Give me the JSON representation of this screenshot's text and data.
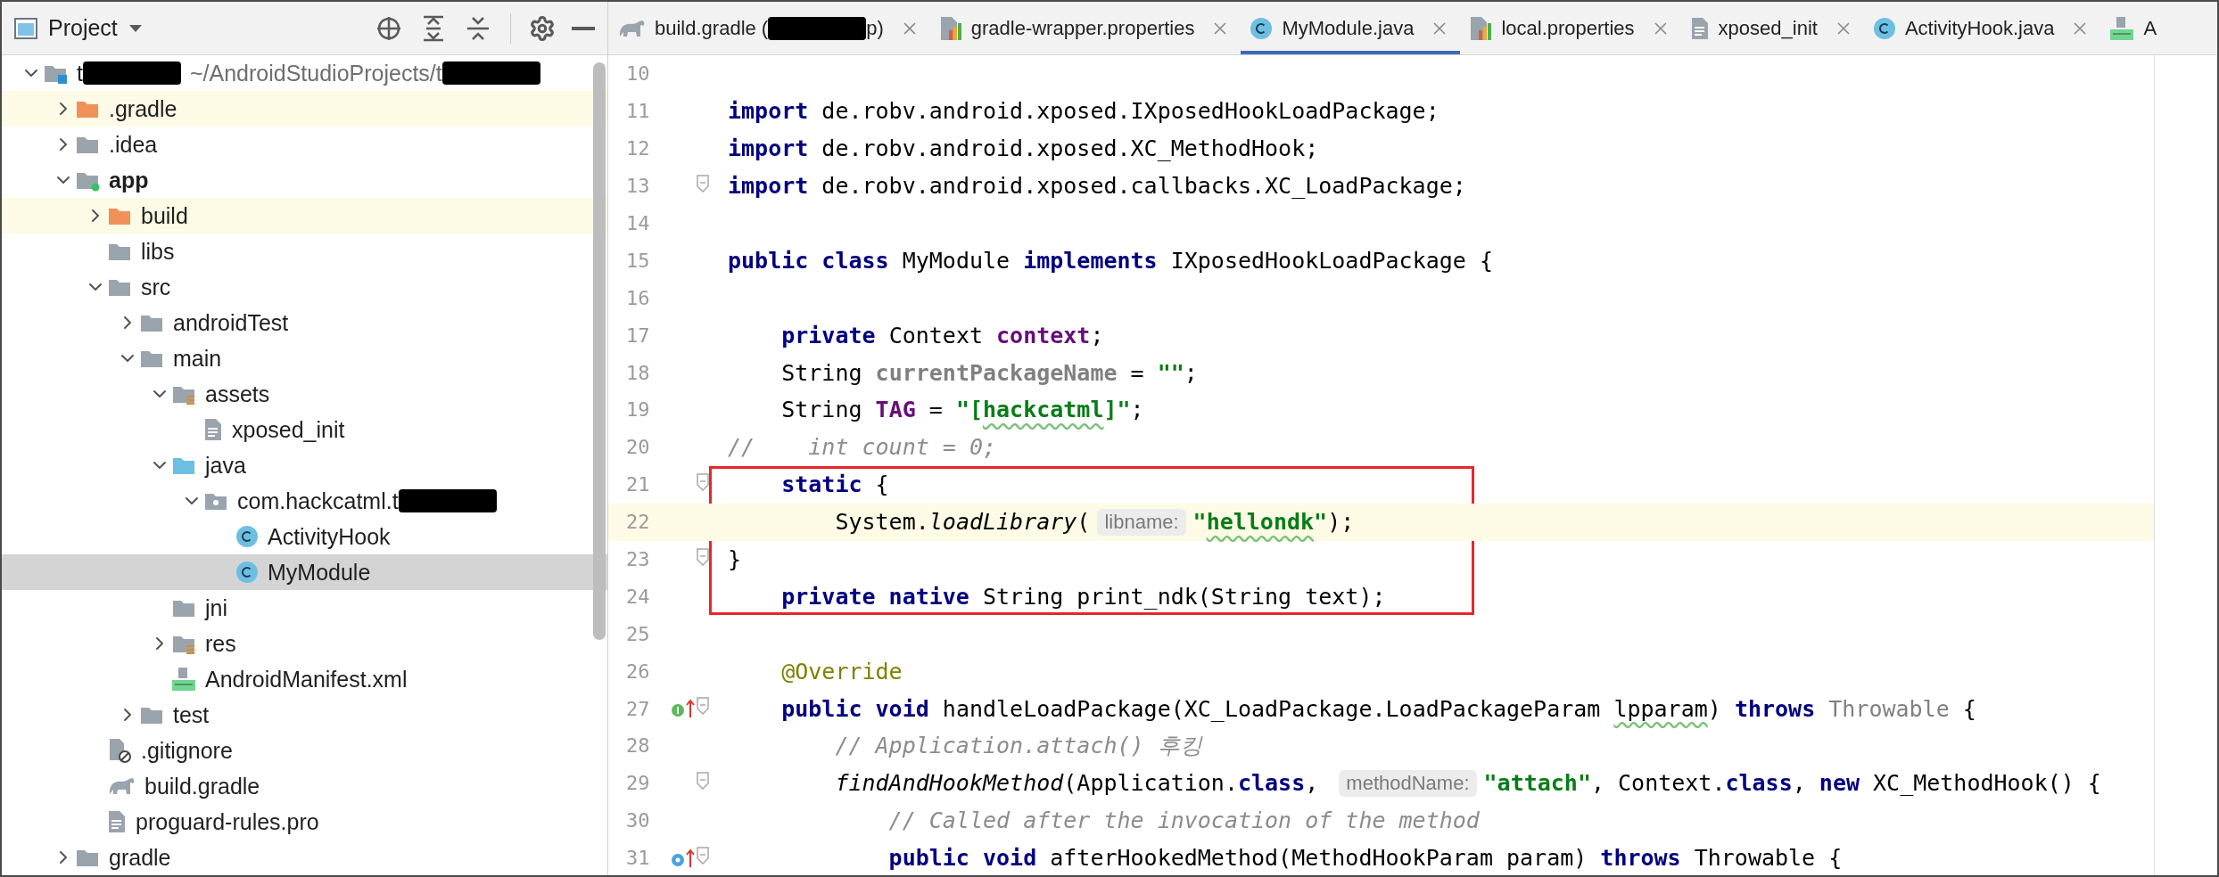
{
  "project_panel": {
    "title": "Project",
    "tree": [
      {
        "parts": [
          {
            "kind": "name",
            "text": "t"
          },
          {
            "kind": "redaction"
          },
          {
            "kind": "path",
            "text": "~/AndroidStudioProjects/t"
          },
          {
            "kind": "redaction"
          }
        ],
        "kind": "module-root",
        "expanded": true,
        "selected": false,
        "excluded": false,
        "bold": false,
        "children": [
          {
            "label": ".gradle",
            "kind": "folder-excluded",
            "expanded": false,
            "selected": false,
            "excluded": true,
            "bold": false
          },
          {
            "label": ".idea",
            "kind": "folder",
            "expanded": false,
            "selected": false,
            "excluded": false,
            "bold": false
          },
          {
            "label": "app",
            "kind": "module",
            "expanded": true,
            "selected": false,
            "excluded": false,
            "bold": true,
            "children": [
              {
                "label": "build",
                "kind": "folder-excluded",
                "expanded": false,
                "selected": false,
                "excluded": true,
                "bold": false
              },
              {
                "label": "libs",
                "kind": "folder",
                "selected": false,
                "excluded": false,
                "bold": false
              },
              {
                "label": "src",
                "kind": "folder",
                "expanded": true,
                "selected": false,
                "excluded": false,
                "bold": false,
                "children": [
                  {
                    "label": "androidTest",
                    "kind": "folder",
                    "expanded": false,
                    "selected": false,
                    "excluded": false,
                    "bold": false
                  },
                  {
                    "label": "main",
                    "kind": "folder",
                    "expanded": true,
                    "selected": false,
                    "excluded": false,
                    "bold": false,
                    "children": [
                      {
                        "label": "assets",
                        "kind": "folder-resources",
                        "expanded": true,
                        "selected": false,
                        "excluded": false,
                        "bold": false,
                        "children": [
                          {
                            "label": "xposed_init",
                            "kind": "file-text",
                            "selected": false,
                            "excluded": false,
                            "bold": false
                          }
                        ]
                      },
                      {
                        "label": "java",
                        "kind": "folder-source",
                        "expanded": true,
                        "selected": false,
                        "excluded": false,
                        "bold": false,
                        "children": [
                          {
                            "parts": [
                              {
                                "kind": "name",
                                "text": "com.hackcatml.t"
                              },
                              {
                                "kind": "redaction"
                              }
                            ],
                            "kind": "folder-package",
                            "expanded": true,
                            "selected": false,
                            "excluded": false,
                            "bold": false,
                            "children": [
                              {
                                "label": "ActivityHook",
                                "kind": "class",
                                "selected": false,
                                "excluded": false,
                                "bold": false
                              },
                              {
                                "label": "MyModule",
                                "kind": "class",
                                "selected": true,
                                "excluded": false,
                                "bold": false
                              }
                            ]
                          }
                        ]
                      },
                      {
                        "label": "jni",
                        "kind": "folder",
                        "selected": false,
                        "excluded": false,
                        "bold": false
                      },
                      {
                        "label": "res",
                        "kind": "folder-resources",
                        "expanded": false,
                        "selected": false,
                        "excluded": false,
                        "bold": false
                      },
                      {
                        "label": "AndroidManifest.xml",
                        "kind": "manifest",
                        "selected": false,
                        "excluded": false,
                        "bold": false
                      }
                    ]
                  },
                  {
                    "label": "test",
                    "kind": "folder",
                    "expanded": false,
                    "selected": false,
                    "excluded": false,
                    "bold": false
                  }
                ]
              },
              {
                "label": ".gitignore",
                "kind": "gitignore",
                "selected": false,
                "excluded": false,
                "bold": false
              },
              {
                "label": "build.gradle",
                "kind": "gradle",
                "selected": false,
                "excluded": false,
                "bold": false
              },
              {
                "label": "proguard-rules.pro",
                "kind": "file-text",
                "selected": false,
                "excluded": false,
                "bold": false
              }
            ]
          },
          {
            "label": "gradle",
            "kind": "folder",
            "expanded": false,
            "selected": false,
            "excluded": false,
            "bold": false
          }
        ]
      }
    ]
  },
  "tabs": [
    {
      "parts": [
        {
          "kind": "name",
          "text": "build.gradle ("
        },
        {
          "kind": "redaction"
        },
        {
          "kind": "name",
          "text": "p)"
        }
      ],
      "kind": "gradle",
      "selected": false,
      "closable": true
    },
    {
      "parts": [
        {
          "kind": "name",
          "text": "gradle-wrapper.properties"
        }
      ],
      "kind": "properties",
      "selected": false,
      "closable": true
    },
    {
      "parts": [
        {
          "kind": "name",
          "text": "MyModule.java"
        }
      ],
      "kind": "class",
      "selected": true,
      "closable": true
    },
    {
      "parts": [
        {
          "kind": "name",
          "text": "local.properties"
        }
      ],
      "kind": "properties",
      "selected": false,
      "closable": true
    },
    {
      "parts": [
        {
          "kind": "name",
          "text": "xposed_init"
        }
      ],
      "kind": "file-text",
      "selected": false,
      "closable": true
    },
    {
      "parts": [
        {
          "kind": "name",
          "text": "ActivityHook.java"
        }
      ],
      "kind": "class",
      "selected": false,
      "closable": true
    },
    {
      "parts": [
        {
          "kind": "name",
          "text": "A"
        }
      ],
      "kind": "manifest",
      "selected": false,
      "closable": false
    }
  ],
  "editor": {
    "lines": [
      {
        "number": "10",
        "current": false,
        "outlined": false,
        "fold": false
      },
      {
        "number": "11",
        "current": false,
        "outlined": false,
        "fold": false,
        "tokens": [
          {
            "kind": "kw",
            "text": "import"
          },
          {
            "kind": "plain",
            "text": " de.robv.android.xposed.IXposedHookLoadPackage;"
          }
        ]
      },
      {
        "number": "12",
        "current": false,
        "outlined": false,
        "fold": false,
        "tokens": [
          {
            "kind": "kw",
            "text": "import"
          },
          {
            "kind": "plain",
            "text": " de.robv.android.xposed.XC_MethodHook;"
          }
        ]
      },
      {
        "number": "13",
        "current": false,
        "outlined": false,
        "fold": true,
        "tokens": [
          {
            "kind": "kw",
            "text": "import"
          },
          {
            "kind": "plain",
            "text": " de.robv.android.xposed.callbacks.XC_LoadPackage;"
          }
        ]
      },
      {
        "number": "14",
        "current": false,
        "outlined": false,
        "fold": false
      },
      {
        "number": "15",
        "current": false,
        "outlined": false,
        "fold": false,
        "tokens": [
          {
            "kind": "kw",
            "text": "public class"
          },
          {
            "kind": "plain",
            "text": " MyModule "
          },
          {
            "kind": "kw",
            "text": "implements"
          },
          {
            "kind": "plain",
            "text": " IXposedHookLoadPackage {"
          }
        ]
      },
      {
        "number": "16",
        "current": false,
        "outlined": false,
        "fold": false
      },
      {
        "number": "17",
        "current": false,
        "outlined": false,
        "fold": false,
        "tokens": [
          {
            "kind": "kw",
            "text": "    private"
          },
          {
            "kind": "plain",
            "text": " Context "
          },
          {
            "kind": "field",
            "text": "context"
          },
          {
            "kind": "plain",
            "text": ";"
          }
        ]
      },
      {
        "number": "18",
        "current": false,
        "outlined": false,
        "fold": false,
        "tokens": [
          {
            "kind": "plain",
            "text": "    String "
          },
          {
            "kind": "unused",
            "text": "currentPackageName"
          },
          {
            "kind": "plain",
            "text": " = "
          },
          {
            "kind": "str",
            "text": "\"\""
          },
          {
            "kind": "plain",
            "text": ";"
          }
        ]
      },
      {
        "number": "19",
        "current": false,
        "outlined": false,
        "fold": false,
        "tokens": [
          {
            "kind": "plain",
            "text": "    String "
          },
          {
            "kind": "field",
            "text": "TAG"
          },
          {
            "kind": "plain",
            "text": " = "
          },
          {
            "kind": "str",
            "text": "\"["
          },
          {
            "kind": "str",
            "text": "hackcatml",
            "typo": true
          },
          {
            "kind": "str",
            "text": "]\""
          },
          {
            "kind": "plain",
            "text": ";"
          }
        ]
      },
      {
        "number": "20",
        "current": false,
        "outlined": false,
        "fold": false,
        "tokens": [
          {
            "kind": "comment",
            "text": "//    int count = 0;"
          }
        ]
      },
      {
        "number": "21",
        "current": false,
        "outlined": true,
        "fold": true,
        "tokens": [
          {
            "kind": "kw",
            "text": "    static"
          },
          {
            "kind": "plain",
            "text": " {"
          }
        ]
      },
      {
        "number": "22",
        "current": true,
        "outlined": true,
        "fold": false,
        "tokens": [
          {
            "kind": "plain",
            "text": "        System."
          },
          {
            "kind": "call",
            "text": "loadLibrary"
          },
          {
            "kind": "plain",
            "text": "("
          },
          {
            "kind": "hint",
            "text": "libname:"
          },
          {
            "kind": "str",
            "text": "\""
          },
          {
            "kind": "str",
            "text": "hellondk",
            "typo": true
          },
          {
            "kind": "str",
            "text": "\""
          },
          {
            "kind": "plain",
            "text": ");"
          }
        ]
      },
      {
        "number": "23",
        "current": false,
        "outlined": true,
        "fold": true,
        "tokens": [
          {
            "kind": "plain",
            "text": "}"
          }
        ]
      },
      {
        "number": "24",
        "current": false,
        "outlined": true,
        "fold": false,
        "tokens": [
          {
            "kind": "kw",
            "text": "    private native"
          },
          {
            "kind": "plain",
            "text": " String print_ndk(String text);"
          }
        ]
      },
      {
        "number": "25",
        "current": false,
        "outlined": false,
        "fold": false
      },
      {
        "number": "26",
        "current": false,
        "outlined": false,
        "fold": false,
        "tokens": [
          {
            "kind": "annotation",
            "text": "    @Override"
          }
        ]
      },
      {
        "number": "27",
        "current": false,
        "outlined": false,
        "fold": true,
        "implements_marker": true,
        "tokens": [
          {
            "kind": "kw",
            "text": "    public void"
          },
          {
            "kind": "plain",
            "text": " handleLoadPackage(XC_LoadPackage.LoadPackageParam "
          },
          {
            "kind": "plain",
            "text": "lpparam",
            "typo": true
          },
          {
            "kind": "plain",
            "text": ") "
          },
          {
            "kind": "kw",
            "text": "throws "
          },
          {
            "kind": "unusedType",
            "text": "Throwable"
          },
          {
            "kind": "plain",
            "text": " {"
          }
        ]
      },
      {
        "number": "28",
        "current": false,
        "outlined": false,
        "fold": false,
        "tokens": [
          {
            "kind": "comment",
            "text": "        // Application.attach() 후킹"
          }
        ]
      },
      {
        "number": "29",
        "current": false,
        "outlined": false,
        "fold": true,
        "tokens": [
          {
            "kind": "call",
            "text": "        findAndHookMethod"
          },
          {
            "kind": "plain",
            "text": "(Application."
          },
          {
            "kind": "kw",
            "text": "class"
          },
          {
            "kind": "plain",
            "text": ", "
          },
          {
            "kind": "hint",
            "text": "methodName:"
          },
          {
            "kind": "str",
            "text": "\"attach\""
          },
          {
            "kind": "plain",
            "text": ", Context."
          },
          {
            "kind": "kw",
            "text": "class"
          },
          {
            "kind": "plain",
            "text": ", "
          },
          {
            "kind": "kw",
            "text": "new"
          },
          {
            "kind": "plain",
            "text": " XC_MethodHook() {"
          }
        ]
      },
      {
        "number": "30",
        "current": false,
        "outlined": false,
        "fold": false,
        "tokens": [
          {
            "kind": "comment",
            "text": "            // Called after the invocation of the method"
          }
        ]
      },
      {
        "number": "31",
        "current": false,
        "outlined": false,
        "fold": true,
        "overrides_marker": true,
        "tokens": [
          {
            "kind": "kw",
            "text": "            public void"
          },
          {
            "kind": "plain",
            "text": " afterHookedMethod(MethodHookParam param) "
          },
          {
            "kind": "kw",
            "text": "throws"
          },
          {
            "kind": "plain",
            "text": " Throwable {"
          }
        ]
      }
    ]
  }
}
